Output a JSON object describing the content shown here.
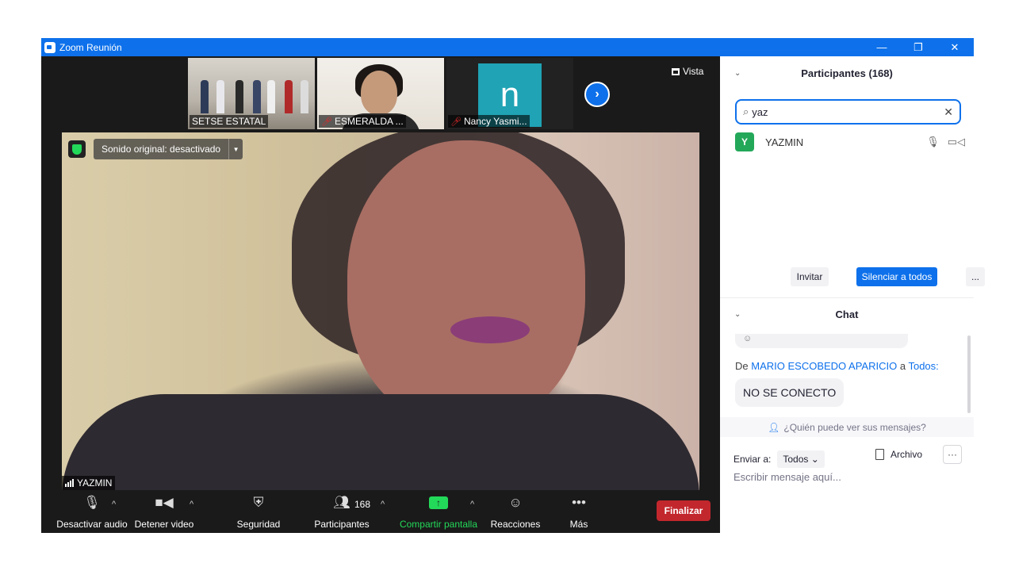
{
  "window": {
    "title": "Zoom Reunión",
    "minimize": "—",
    "restore": "❐",
    "close": "✕"
  },
  "thumbnails": [
    {
      "name": "SETSE ESTATAL",
      "muted": false
    },
    {
      "name": "ESMERALDA ...",
      "muted": true
    },
    {
      "name": "Nancy  Yasmi...",
      "muted": true,
      "avatar_letter": "n",
      "avatar_color": "#1fa3b5"
    }
  ],
  "next_icon": "›",
  "view_label": "Vista",
  "main_video": {
    "sound_label": "Sonido original: desactivado",
    "name": "YAZMIN"
  },
  "toolbar": {
    "mute_audio": "Desactivar audio",
    "stop_video": "Detener video",
    "security": "Seguridad",
    "participants": "Participantes",
    "participants_count": "168",
    "share_screen": "Compartir pantalla",
    "reactions": "Reacciones",
    "more": "Más",
    "end": "Finalizar"
  },
  "participants_panel": {
    "title": "Participantes (168)",
    "search_value": "yaz",
    "results": [
      {
        "initial": "Y",
        "name": "YAZMIN",
        "avatar_color": "#23a859"
      }
    ],
    "invite": "Invitar",
    "mute_all": "Silenciar a todos",
    "more": "..."
  },
  "chat_panel": {
    "title": "Chat",
    "from_prefix": "De",
    "sender": "MARIO ESCOBEDO APARICIO",
    "to_word": "a",
    "recipient": "Todos:",
    "message": "NO SE CONECTO",
    "who_can_see": "¿Quién puede ver sus mensajes?",
    "send_to_label": "Enviar a:",
    "send_to_value": "Todos",
    "file": "Archivo",
    "more": "···",
    "input_placeholder": "Escribir mensaje aquí..."
  },
  "colors": {
    "zoom_blue": "#0e71eb",
    "end_red": "#c2272d",
    "share_green": "#23d959"
  }
}
